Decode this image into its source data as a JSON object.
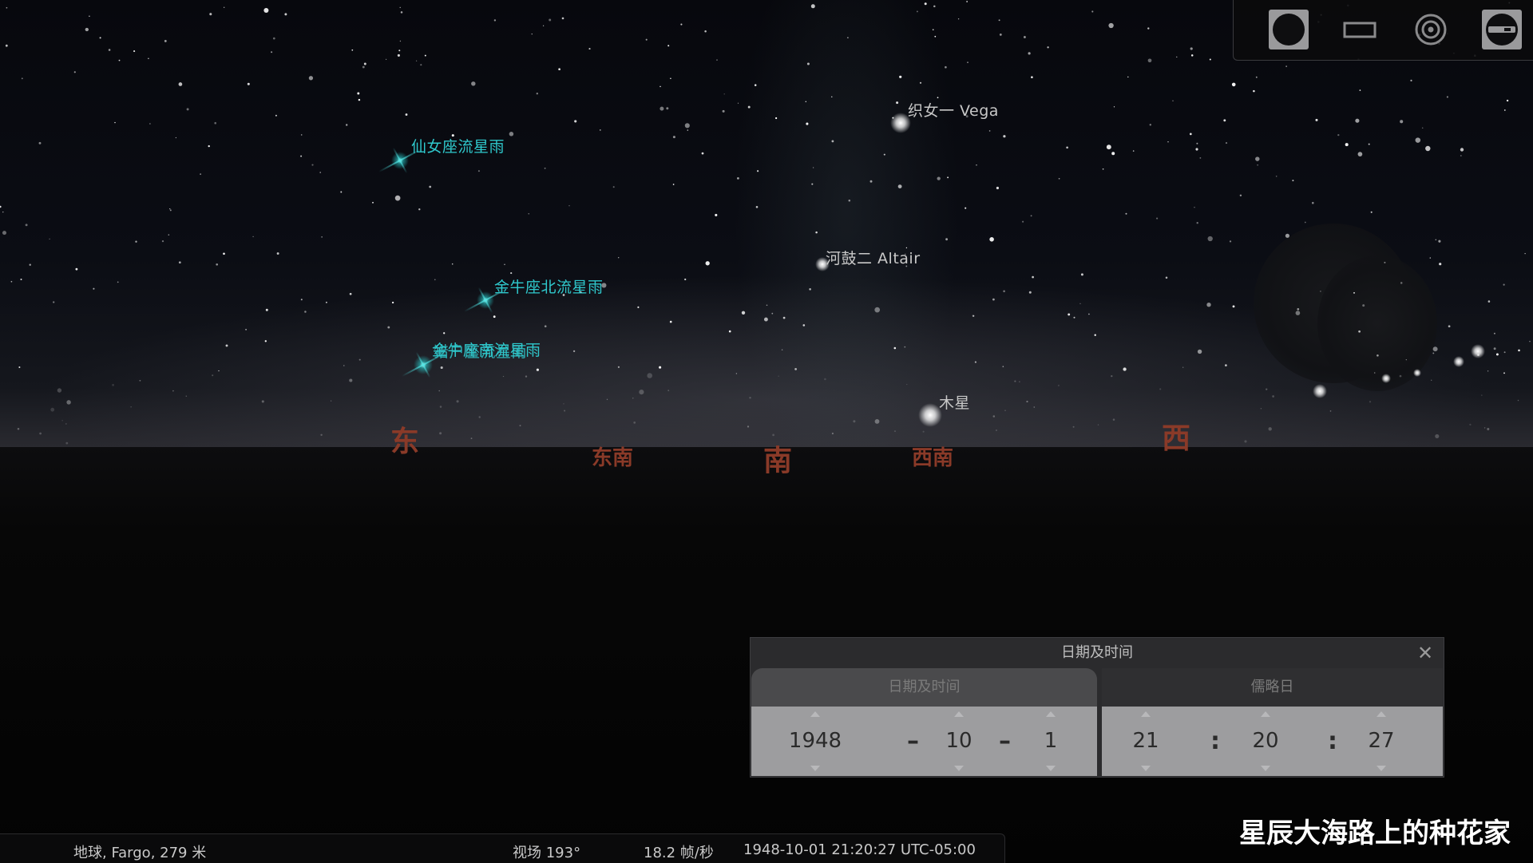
{
  "sky": {
    "meteor_showers": [
      {
        "label": "仙女座流星雨"
      },
      {
        "label": "金牛座北流星雨"
      },
      {
        "label": "金牛座南流星雨"
      },
      {
        "label": "猎户座流星雨"
      }
    ],
    "stars": {
      "vega": "织女一 Vega",
      "altair": "河鼓二 Altair",
      "jupiter": "木星"
    },
    "cardinals": {
      "east": "东",
      "southeast": "东南",
      "south": "南",
      "southwest": "西南",
      "west": "西"
    }
  },
  "toolbar": {
    "buttons": [
      {
        "icon": "circle-icon"
      },
      {
        "icon": "rectangle-icon"
      },
      {
        "icon": "target-icon"
      },
      {
        "icon": "toggle-icon"
      }
    ]
  },
  "date_dialog": {
    "title": "日期及时间",
    "tabs": {
      "date_time": "日期及时间",
      "julian": "儒略日"
    },
    "year": "1948",
    "month": "10",
    "day": "1",
    "date_sep": "–",
    "hour": "21",
    "minute": "20",
    "second": "27",
    "time_sep": ":",
    "close_glyph": "✕"
  },
  "status_bar": {
    "location": "地球, Fargo, 279 米",
    "fov": "视场 193°",
    "fps": "18.2 帧/秒",
    "datetime": "1948-10-01 21:20:27 UTC-05:00"
  },
  "watermark": "星辰大海路上的种花家",
  "colors": {
    "meteor_label": "#2fc8cc",
    "star_label": "#c8c8c8",
    "cardinal": "#8a3a28"
  }
}
